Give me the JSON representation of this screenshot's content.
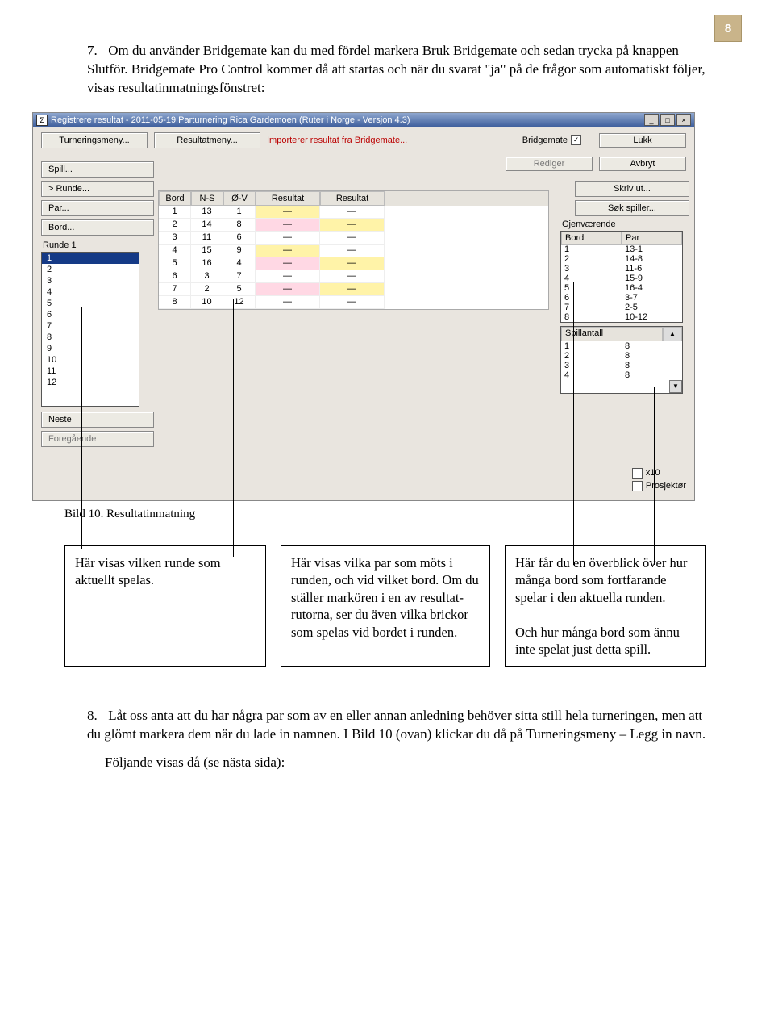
{
  "page_number": "8",
  "para7_num": "7.",
  "para7_text": "Om du använder Bridgemate kan du med fördel markera Bruk Bridgemate och sedan trycka på knappen Slutför. Bridgemate Pro Control kommer då att startas och när du svarat \"ja\" på de frågor som automatiskt följer, visas resultatinmatningsfönstret:",
  "caption": "Bild 10. Resultatinmatning",
  "callout1": "Här visas vilken runde som aktuellt spelas.",
  "callout2": "Här visas vilka par som möts i runden, och vid vilket bord. Om du ställer markören i en av resultat-rutorna, ser du även vilka brickor som spelas vid bordet i runden.",
  "callout3a": "Här får du en överblick över hur många bord som fortfarande spelar i den aktuella runden.",
  "callout3b": "Och hur många bord som ännu inte spelat just detta spill.",
  "para8_num": "8.",
  "para8_text": "Låt oss anta att du har några par som av en eller annan anledning behöver sitta still hela turneringen, men att du glömt markera dem när du lade in namnen. I Bild 10 (ovan) klickar du då på Turneringsmeny – Legg in navn.",
  "para8_follow": "Följande visas då (se nästa sida):",
  "win": {
    "title": "Registrere resultat - 2011-05-19  Parturnering Rica Gardemoen  (Ruter i Norge - Versjon 4.3)",
    "menu": {
      "turn": "Turneringsmeny...",
      "res": "Resultatmeny...",
      "import": "Importerer resultat fra Bridgemate...",
      "bm": "Bridgemate",
      "lukk": "Lukk",
      "rediger": "Rediger",
      "avbryt": "Avbryt",
      "skriv": "Skriv ut...",
      "sok": "Søk spiller..."
    },
    "left": {
      "spill": "Spill...",
      "runde": ">   Runde...",
      "par": "Par...",
      "bord": "Bord...",
      "rlabel": "Runde 1",
      "items": [
        "1",
        "2",
        "3",
        "4",
        "5",
        "6",
        "7",
        "8",
        "9",
        "10",
        "11",
        "12"
      ],
      "neste": "Neste",
      "fore": "Foregående"
    },
    "table": {
      "headers": [
        "Bord",
        "N-S",
        "Ø-V",
        "Resultat",
        "Resultat"
      ],
      "rows": [
        {
          "bord": "1",
          "ns": "13",
          "ov": "1",
          "r1": "—",
          "r2": "—",
          "c1": "bg-y",
          "c2": "bg-w"
        },
        {
          "bord": "2",
          "ns": "14",
          "ov": "8",
          "r1": "—",
          "r2": "—",
          "c1": "bg-p",
          "c2": "bg-y"
        },
        {
          "bord": "3",
          "ns": "11",
          "ov": "6",
          "r1": "—",
          "r2": "—",
          "c1": "bg-w",
          "c2": "bg-w"
        },
        {
          "bord": "4",
          "ns": "15",
          "ov": "9",
          "r1": "—",
          "r2": "—",
          "c1": "bg-y",
          "c2": "bg-w"
        },
        {
          "bord": "5",
          "ns": "16",
          "ov": "4",
          "r1": "—",
          "r2": "—",
          "c1": "bg-p",
          "c2": "bg-y"
        },
        {
          "bord": "6",
          "ns": "3",
          "ov": "7",
          "r1": "—",
          "r2": "—",
          "c1": "bg-w",
          "c2": "bg-w"
        },
        {
          "bord": "7",
          "ns": "2",
          "ov": "5",
          "r1": "—",
          "r2": "—",
          "c1": "bg-p",
          "c2": "bg-y"
        },
        {
          "bord": "8",
          "ns": "10",
          "ov": "12",
          "r1": "—",
          "r2": "—",
          "c1": "bg-w",
          "c2": "bg-w"
        }
      ]
    },
    "right": {
      "gjen": "Gjenværende",
      "gjen_hdr": [
        "Bord",
        "Par"
      ],
      "gjen_rows": [
        {
          "b": "1",
          "p": "13-1"
        },
        {
          "b": "2",
          "p": "14-8"
        },
        {
          "b": "3",
          "p": "11-6"
        },
        {
          "b": "4",
          "p": "15-9"
        },
        {
          "b": "5",
          "p": "16-4"
        },
        {
          "b": "6",
          "p": "3-7"
        },
        {
          "b": "7",
          "p": "2-5"
        },
        {
          "b": "8",
          "p": "10-12"
        }
      ],
      "spill": "Spillantall",
      "spill_rows": [
        {
          "a": "1",
          "b": "8"
        },
        {
          "a": "2",
          "b": "8"
        },
        {
          "a": "3",
          "b": "8"
        },
        {
          "a": "4",
          "b": "8"
        }
      ],
      "x10": "x10",
      "proj": "Prosjektør"
    }
  }
}
